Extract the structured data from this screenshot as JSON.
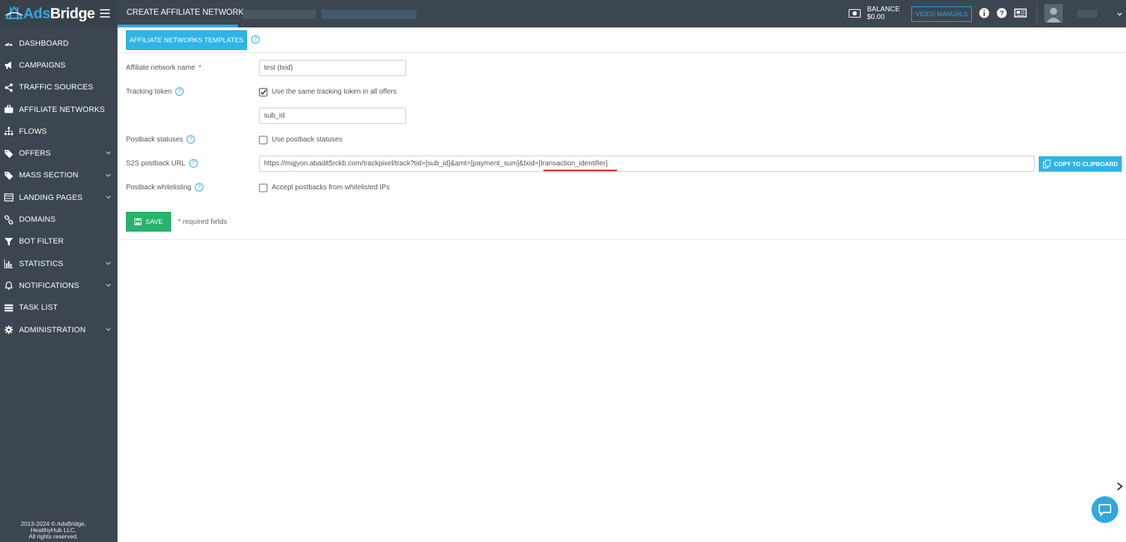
{
  "logo": {
    "brand_ads": "Ads",
    "brand_bridge": "Bridge"
  },
  "sidebar": {
    "items": [
      {
        "label": "DASHBOARD",
        "icon": "dashboard-icon",
        "has_chevron": false
      },
      {
        "label": "CAMPAIGNS",
        "icon": "megaphone-icon",
        "has_chevron": false
      },
      {
        "label": "TRAFFIC SOURCES",
        "icon": "share-icon",
        "has_chevron": false
      },
      {
        "label": "AFFILIATE NETWORKS",
        "icon": "briefcase-icon",
        "has_chevron": false
      },
      {
        "label": "FLOWS",
        "icon": "sitemap-icon",
        "has_chevron": false
      },
      {
        "label": "OFFERS",
        "icon": "tag-icon",
        "has_chevron": true
      },
      {
        "label": "MASS SECTION",
        "icon": "tags-icon",
        "has_chevron": true
      },
      {
        "label": "LANDING PAGES",
        "icon": "list-icon",
        "has_chevron": true
      },
      {
        "label": "DOMAINS",
        "icon": "link-icon",
        "has_chevron": false
      },
      {
        "label": "BOT FILTER",
        "icon": "filter-icon",
        "has_chevron": false
      },
      {
        "label": "STATISTICS",
        "icon": "bar-chart-icon",
        "has_chevron": true
      },
      {
        "label": "NOTIFICATIONS",
        "icon": "bell-icon",
        "has_chevron": true
      },
      {
        "label": "TASK LIST",
        "icon": "tasks-icon",
        "has_chevron": false
      },
      {
        "label": "ADMINISTRATION",
        "icon": "gear-icon",
        "has_chevron": true
      }
    ],
    "footer_line1": "2013-2024 © AdsBridge,",
    "footer_line2": "HealthyHub LLC.",
    "footer_line3": "All rights reserved."
  },
  "topbar": {
    "title": "CREATE AFFILIATE NETWORK",
    "balance_label": "BALANCE",
    "balance_value": "$0.00",
    "video_manuals": "VIDEO MANUALS"
  },
  "form": {
    "templates_button": "AFFILIATE NETWORKS TEMPLATES",
    "network_name_label": "Affiliate network name",
    "network_name_value": "test (txid)",
    "tracking_token_label": "Tracking token",
    "same_token_label": "Use the same tracking token in all offers",
    "same_token_checked": true,
    "tracking_token_value": "sub_id",
    "postback_statuses_label": "Postback statuses",
    "use_postback_statuses_label": "Use postback statuses",
    "use_postback_statuses_checked": false,
    "s2s_label": "S2S postback URL",
    "s2s_url_prefix": "https://mqjyon.abadit5rckb.com/trackpixel/track?tid=[sub_id]&amt=[payment_sum]&txid=",
    "s2s_url_highlight": "[transaction_identifier]",
    "copy_button": "COPY TO CLIPBOARD",
    "whitelisting_label": "Postback whitelisting",
    "accept_whitelisted_label": "Accept postbacks from whitelisted IPs",
    "accept_whitelisted_checked": false,
    "save_button": "SAVE",
    "required_note": "required fields",
    "required_star": "*"
  },
  "colors": {
    "sidebar_bg": "#3c4650",
    "accent": "#2fb4e6",
    "save_green": "#26b36b",
    "highlight_red": "#e0262b"
  }
}
